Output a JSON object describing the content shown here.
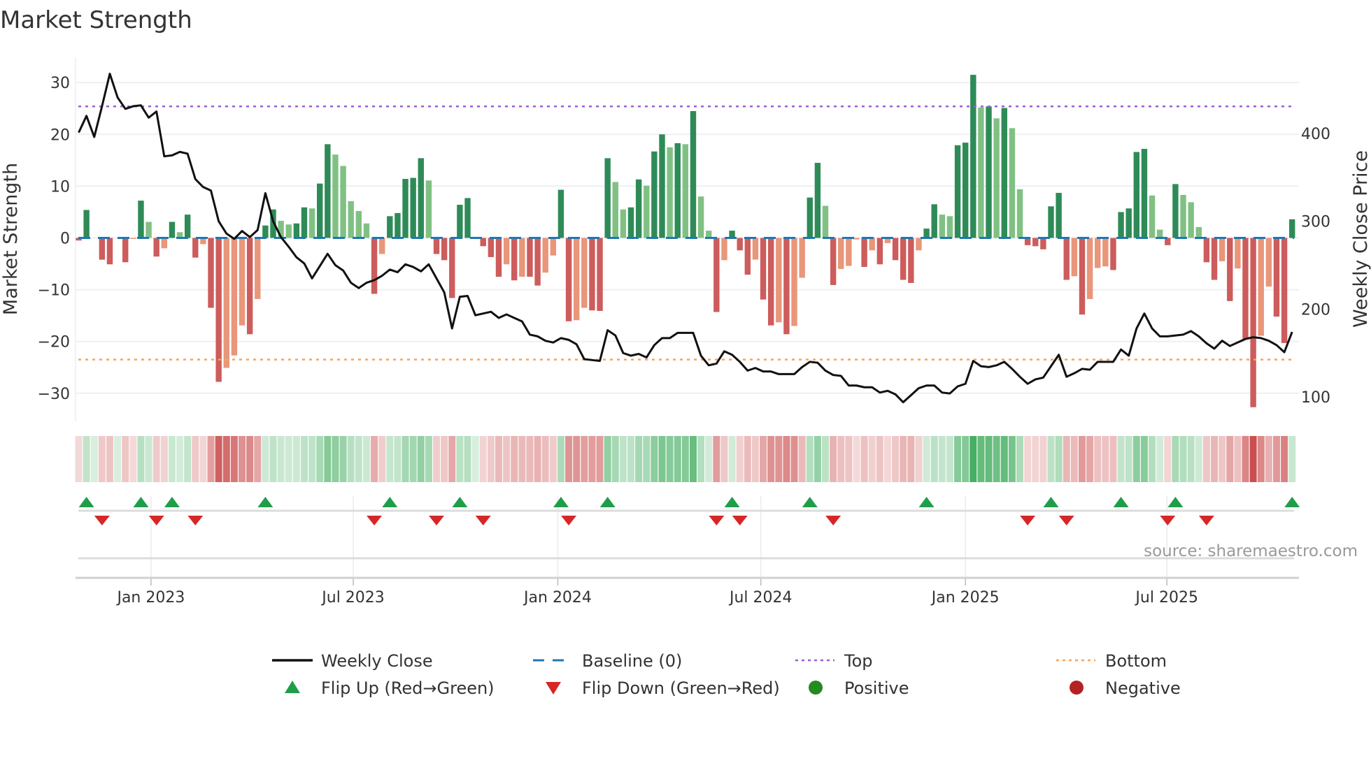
{
  "chart_data": {
    "type": "bar",
    "title": "Market Strength",
    "ylabel": "Market Strength",
    "y2label": "Weekly Close Price",
    "ylim": [
      -35,
      35
    ],
    "y2lim": [
      65,
      465
    ],
    "yticks": [
      {
        "value": 30,
        "label": "30"
      },
      {
        "value": 20,
        "label": "20"
      },
      {
        "value": 10,
        "label": "10"
      },
      {
        "value": 0,
        "label": "0"
      },
      {
        "value": -10,
        "label": "−10"
      },
      {
        "value": -20,
        "label": "−20"
      },
      {
        "value": -30,
        "label": "−30"
      }
    ],
    "y2ticks": [
      {
        "value": 400,
        "label": "400"
      },
      {
        "value": 300,
        "label": "300"
      },
      {
        "value": 200,
        "label": "200"
      },
      {
        "value": 100,
        "label": "100"
      }
    ],
    "xticks": [
      {
        "week": 9.3,
        "label": "Jan 2023"
      },
      {
        "week": 35.3,
        "label": "Jul 2023"
      },
      {
        "week": 61.6,
        "label": "Jan 2024"
      },
      {
        "week": 87.7,
        "label": "Jul 2024"
      },
      {
        "week": 114.0,
        "label": "Jan 2025"
      },
      {
        "week": 139.9,
        "label": "Jul 2025"
      }
    ],
    "grid": true,
    "top_level": 25.4,
    "bottom_level": -23.5,
    "baseline": 0,
    "strength": [
      -0.5,
      5.4,
      0,
      -4.2,
      -5.1,
      0,
      -4.7,
      -0.2,
      7.2,
      3.1,
      -3.6,
      -2.0,
      3.1,
      1.1,
      4.5,
      -3.8,
      -1.2,
      -13.5,
      -27.8,
      -25.1,
      -22.7,
      -16.9,
      -18.6,
      -11.8,
      2.4,
      5.5,
      3.3,
      2.6,
      2.8,
      5.9,
      5.7,
      10.5,
      18.1,
      16.1,
      13.9,
      7.1,
      5.2,
      2.8,
      -10.8,
      -3.1,
      4.2,
      4.8,
      11.4,
      11.6,
      15.4,
      11.1,
      -3.1,
      -4.3,
      -11.6,
      6.4,
      7.7,
      0,
      -1.6,
      -3.7,
      -7.5,
      -5.1,
      -8.2,
      -7.5,
      -7.5,
      -9.2,
      -6.7,
      -3.4,
      9.3,
      -16.1,
      -15.9,
      -13.5,
      -14.0,
      -14.1,
      15.4,
      10.8,
      5.5,
      5.9,
      11.3,
      10.1,
      16.7,
      20.0,
      17.5,
      18.3,
      18.1,
      24.5,
      8.0,
      1.4,
      -14.3,
      -4.3,
      1.4,
      -2.4,
      -7.1,
      -4.2,
      -11.9,
      -16.9,
      -16.3,
      -18.6,
      -17.0,
      -7.7,
      7.8,
      14.5,
      6.2,
      -9.1,
      -6.0,
      -5.4,
      -0.3,
      -5.6,
      -2.4,
      -5.1,
      -1.0,
      -4.3,
      -8.1,
      -8.7,
      -2.4,
      1.8,
      6.5,
      4.5,
      4.2,
      17.9,
      18.4,
      31.5,
      25.2,
      25.4,
      23.1,
      25.1,
      21.2,
      9.4,
      -1.4,
      -1.6,
      -2.2,
      6.1,
      8.7,
      -8.1,
      -7.4,
      -14.8,
      -11.8,
      -5.8,
      -5.5,
      -6.2,
      5.0,
      5.7,
      16.6,
      17.2,
      8.2,
      1.6,
      -1.4,
      10.4,
      8.3,
      6.9,
      2.1,
      -4.7,
      -8.1,
      -4.5,
      -12.2,
      -5.9,
      -19.5,
      -32.7,
      -18.9,
      -9.4,
      -15.2,
      -20.3,
      3.6
    ],
    "weekly_close": [
      401,
      420,
      396,
      431,
      468,
      441,
      428,
      431,
      432,
      418,
      425,
      374,
      375,
      379,
      377,
      348,
      339,
      335,
      300,
      286,
      280,
      289,
      282,
      290,
      332,
      300,
      282,
      271,
      259,
      252,
      235,
      249,
      263,
      250,
      244,
      230,
      224,
      230,
      233,
      238,
      245,
      242,
      251,
      248,
      243,
      251,
      235,
      219,
      178,
      214,
      215,
      193,
      195,
      197,
      190,
      194,
      190,
      186,
      171,
      169,
      164,
      162,
      167,
      165,
      160,
      143,
      142,
      141,
      176,
      170,
      150,
      147,
      149,
      145,
      159,
      167,
      167,
      173,
      173,
      173,
      147,
      136,
      138,
      152,
      148,
      140,
      130,
      133,
      129,
      129,
      126,
      126,
      126,
      134,
      140,
      139,
      130,
      125,
      124,
      113,
      113,
      111,
      111,
      105,
      107,
      103,
      94,
      102,
      110,
      113,
      113,
      105,
      104,
      112,
      115,
      141,
      135,
      134,
      136,
      140,
      132,
      123,
      115,
      120,
      122,
      135,
      148,
      123,
      127,
      132,
      131,
      140,
      140,
      140,
      154,
      147,
      178,
      195,
      178,
      169,
      169,
      170,
      171,
      175,
      169,
      161,
      155,
      164,
      158,
      162,
      166,
      168,
      167,
      164,
      159,
      151,
      174
    ],
    "flip_up_weeks": [
      1,
      8,
      12,
      24,
      40,
      49,
      62,
      68,
      84,
      94,
      109,
      125,
      134,
      141,
      156
    ],
    "flip_down_weeks": [
      3,
      10,
      15,
      38,
      46,
      52,
      63,
      82,
      85,
      97,
      122,
      127,
      140,
      145
    ],
    "legend": {
      "placement": "bottom",
      "items": [
        {
          "key": "weekly_close",
          "label": "Weekly Close"
        },
        {
          "key": "baseline",
          "label": "Baseline (0)"
        },
        {
          "key": "top",
          "label": "Top"
        },
        {
          "key": "bottom",
          "label": "Bottom"
        },
        {
          "key": "flip_up",
          "label": "Flip Up (Red→Green)"
        },
        {
          "key": "flip_down",
          "label": "Flip Down (Green→Red)"
        },
        {
          "key": "positive",
          "label": "Positive"
        },
        {
          "key": "negative",
          "label": "Negative"
        }
      ]
    },
    "source": "source: sharemaestro.com",
    "colors": {
      "pos_rising": "#2e8b57",
      "pos_falling": "#80c183",
      "neg_falling": "#cd5c5c",
      "neg_rising": "#e9967a",
      "line": "#111111",
      "baseline": "#1f77b4",
      "top": "#9b5fd6",
      "bottom": "#f2a65a",
      "flip_up": "#1f9e4a",
      "flip_down": "#d62728",
      "positive": "#228b22",
      "negative": "#b22222"
    }
  }
}
